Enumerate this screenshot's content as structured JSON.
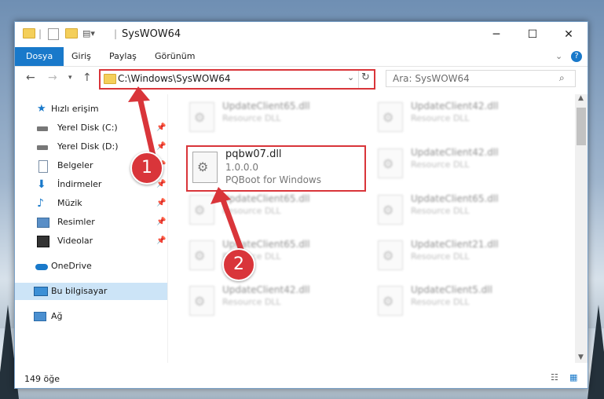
{
  "window": {
    "title": "SysWOW64"
  },
  "ribbon": {
    "tabs": [
      "Dosya",
      "Giriş",
      "Paylaş",
      "Görünüm"
    ]
  },
  "address": {
    "path": "C:\\Windows\\SysWOW64"
  },
  "search": {
    "placeholder": "Ara: SysWOW64"
  },
  "sidebar": {
    "items": [
      {
        "label": "Hızlı erişim",
        "icon": "star-icon"
      },
      {
        "label": "Yerel Disk (C:)",
        "icon": "drive-icon"
      },
      {
        "label": "Yerel Disk (D:)",
        "icon": "drive-icon"
      },
      {
        "label": "Belgeler",
        "icon": "document-icon"
      },
      {
        "label": "İndirmeler",
        "icon": "download-icon"
      },
      {
        "label": "Müzik",
        "icon": "music-icon"
      },
      {
        "label": "Resimler",
        "icon": "picture-icon"
      },
      {
        "label": "Videolar",
        "icon": "video-icon"
      },
      {
        "label": "OneDrive",
        "icon": "cloud-icon"
      },
      {
        "label": "Bu bilgisayar",
        "icon": "computer-icon"
      },
      {
        "label": "Ağ",
        "icon": "network-icon"
      }
    ]
  },
  "files": [
    {
      "name": "UpdateClient65.dll",
      "desc": "Resource DLL"
    },
    {
      "name": "UpdateClient42.dll",
      "desc": "Resource DLL"
    },
    {
      "name": "UpdateClient42.dll",
      "desc": "Resource DLL"
    },
    {
      "name": "UpdateClient65.dll",
      "desc": "Resource DLL"
    },
    {
      "name": "UpdateClient65.dll",
      "desc": "Resource DLL"
    },
    {
      "name": "UpdateClient65.dll",
      "desc": "Resource DLL"
    },
    {
      "name": "UpdateClient21.dll",
      "desc": "Resource DLL"
    },
    {
      "name": "UpdateClient42.dll",
      "desc": "Resource DLL"
    },
    {
      "name": "UpdateClient5.dll",
      "desc": "Resource DLL"
    }
  ],
  "highlighted_file": {
    "name": "pqbw07.dll",
    "version": "1.0.0.0",
    "desc": "PQBoot for Windows"
  },
  "status": {
    "count": "149 öğe"
  },
  "annotations": {
    "badge1": "1",
    "badge2": "2"
  },
  "colors": {
    "accent": "#1979ca",
    "highlight": "#d9353a"
  }
}
